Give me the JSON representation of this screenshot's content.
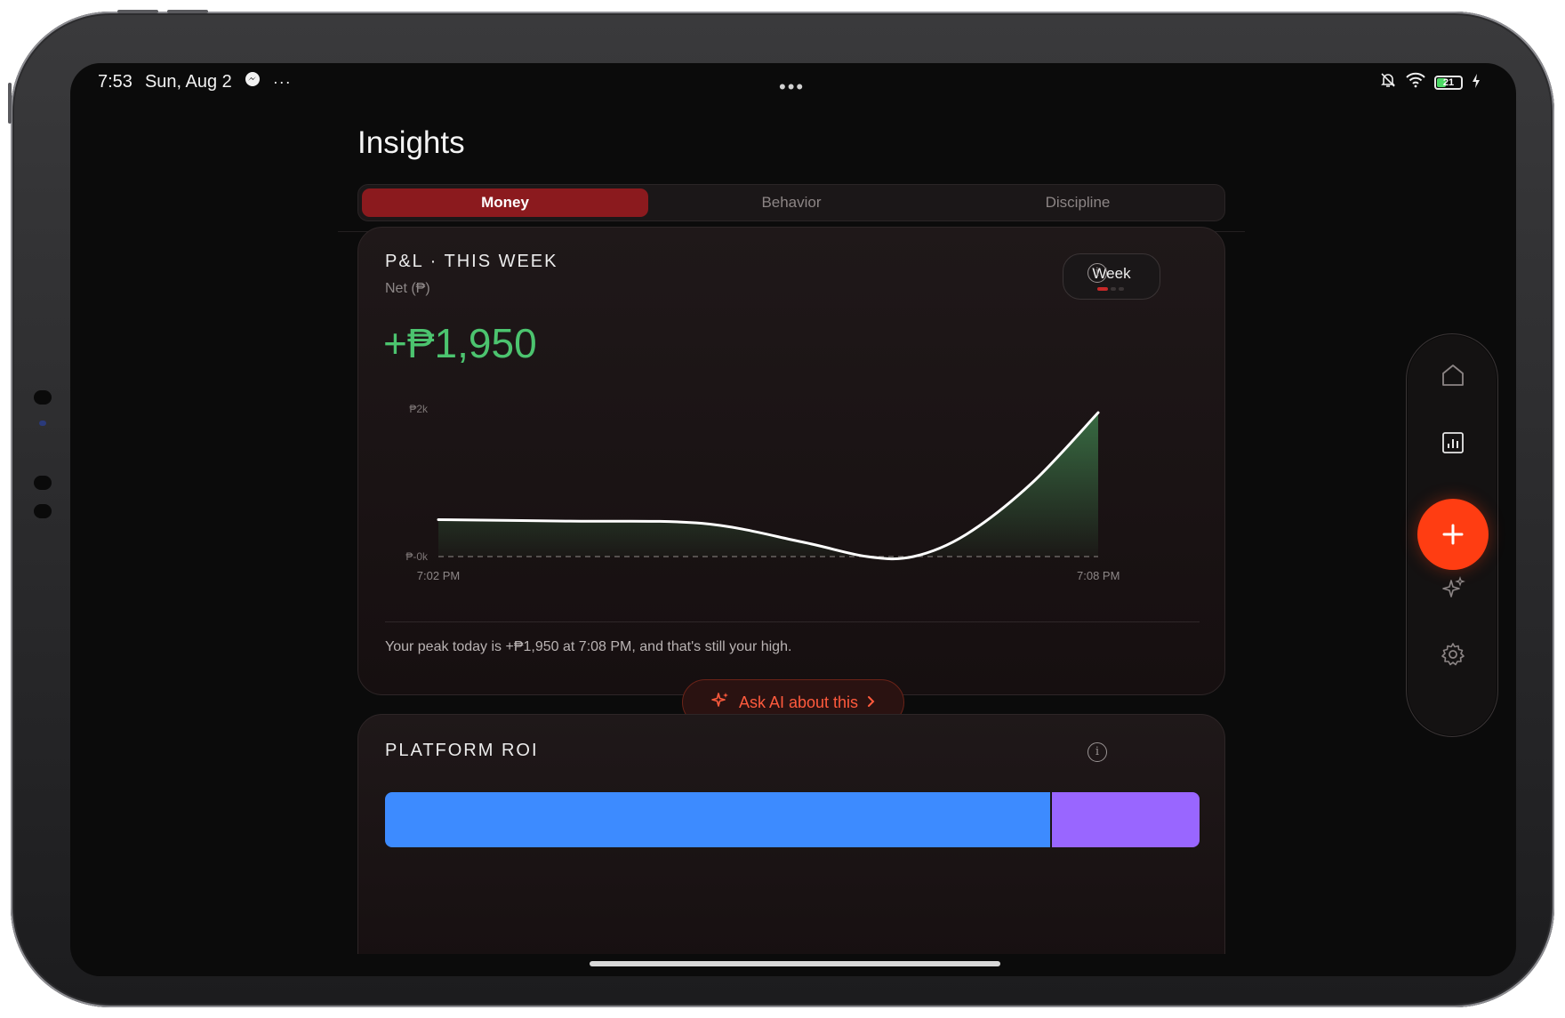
{
  "status_bar": {
    "time": "7:53",
    "date": "Sun, Aug 2",
    "more_dots": "···",
    "center_dots": "•••",
    "battery_level": "21"
  },
  "page": {
    "title": "Insights"
  },
  "tabs": [
    {
      "label": "Money",
      "active": true
    },
    {
      "label": "Behavior",
      "active": false
    },
    {
      "label": "Discipline",
      "active": false
    }
  ],
  "pnl_card": {
    "title": "P&L · THIS WEEK",
    "subtitle": "Net (₱)",
    "value": "+₱1,950",
    "period_button": "Week",
    "insight": "Your peak today is +₱1,950 at 7:08 PM, and that's still your high.",
    "ask_ai_label": "Ask AI about this",
    "colors": {
      "positive": "#4cc46f",
      "accent": "#ff5a3d"
    }
  },
  "chart_data": {
    "type": "area",
    "y_tick_labels": [
      "₱2k",
      "₱-0k"
    ],
    "x_tick_labels": [
      "7:02 PM",
      "7:08 PM"
    ],
    "ylim": [
      0,
      2000
    ],
    "x": [
      0,
      0.2,
      0.4,
      0.55,
      0.65,
      0.72,
      0.8,
      0.9,
      1.0
    ],
    "values": [
      500,
      480,
      450,
      200,
      0,
      0,
      300,
      1000,
      1950
    ],
    "baseline": 0,
    "line_color": "#ffffff",
    "fill_color": "#3d7a4a"
  },
  "roi_card": {
    "title": "PLATFORM ROI",
    "segments": [
      {
        "share": 0.817,
        "color": "#3d8bff"
      },
      {
        "share": 0.183,
        "color": "#9966ff"
      }
    ]
  },
  "rail": {
    "icons": [
      "home-icon",
      "chart-icon",
      "add-icon",
      "sparkle-icon",
      "gear-icon"
    ],
    "fab_color": "#ff3d12"
  }
}
